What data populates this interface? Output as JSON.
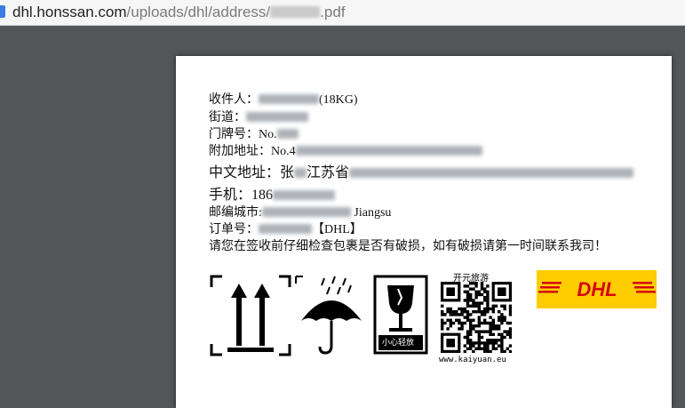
{
  "browser": {
    "url_host": "dhl.honssan.com",
    "url_path": "/uploads/dhl/address/",
    "url_ext": ".pdf"
  },
  "label": {
    "recipient_label": "收件人：",
    "recipient_weight": "(18KG)",
    "street_label": "街道：",
    "house_label": "门牌号：No.",
    "extra_label": "附加地址：No.4",
    "cn_address_label": "中文地址：张",
    "cn_address_province": "江苏省",
    "phone_label": "手机：",
    "phone_prefix": "186",
    "postal_label": "邮编城市:",
    "postal_province": "Jiangsu",
    "order_label": "订单号：",
    "order_suffix": "【DHL】",
    "notice": "请您在签收前仔细检查包裹是否有破损，如有破损请第一时间联系我司！"
  },
  "marks": {
    "fragile_text": "小心轻放",
    "qr_title": "开元旅游",
    "qr_url": "www.kaiyuan.eu",
    "dhl_logo": "DHL"
  },
  "colors": {
    "dhl_yellow": "#ffcc00",
    "dhl_red": "#d40511",
    "viewer_bg": "#525659"
  }
}
